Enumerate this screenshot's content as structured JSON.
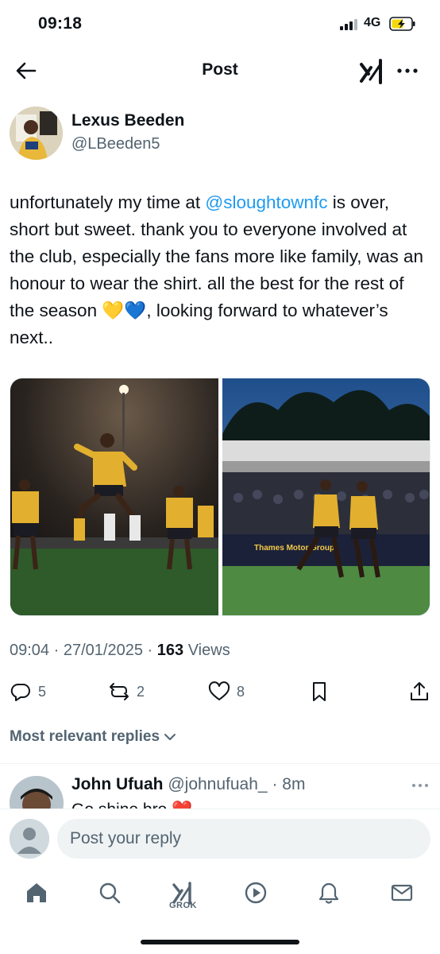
{
  "status": {
    "time": "09:18",
    "network": "4G"
  },
  "nav": {
    "title": "Post"
  },
  "author": {
    "name": "Lexus Beeden",
    "handle": "@LBeeden5"
  },
  "tweet": {
    "before_mention": "unfortunately my time at ",
    "mention": "@sloughtownfc",
    "after_mention": " is over, short but sweet.  thank you to everyone involved at the club, especially the fans more like family, was an honour to wear the shirt. all the best for the rest of the season 💛💙, looking forward to whatever’s next..",
    "media_banner_text": "Thames Motor Group"
  },
  "meta": {
    "time": "09:04",
    "date": "27/01/2025",
    "views_count": "163",
    "views_label": "Views",
    "sep": "·"
  },
  "actions": {
    "replies": "5",
    "reposts": "2",
    "likes": "8"
  },
  "sort": {
    "label": "Most relevant replies"
  },
  "reply": {
    "name": "John Ufuah",
    "handle": "@johnufuah_",
    "time": "· 8m",
    "text": "Go shine bro ❤️"
  },
  "composer": {
    "placeholder": "Post your reply"
  },
  "tabbar": {
    "grok_label": "GROK"
  },
  "colors": {
    "accent": "#1d9bf0",
    "text": "#0f1419",
    "muted": "#536471",
    "shirt_yellow": "#e8b630"
  }
}
